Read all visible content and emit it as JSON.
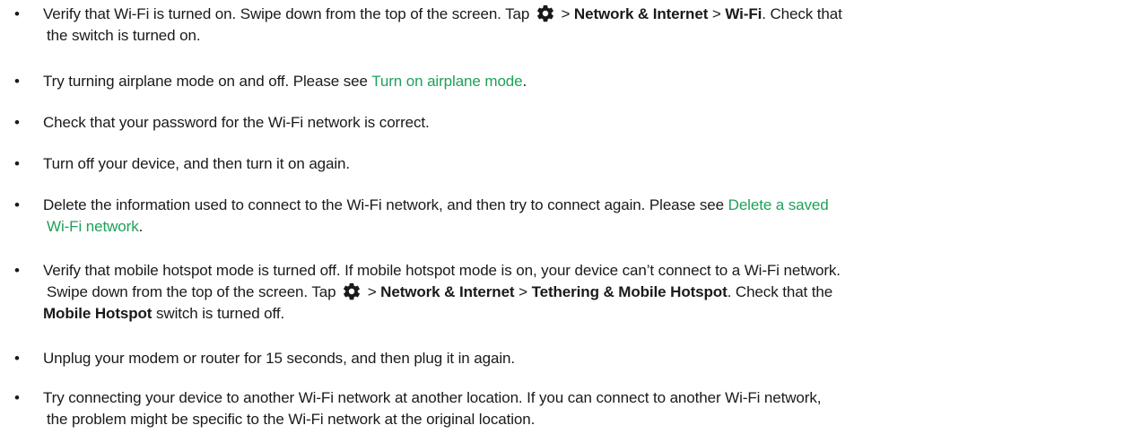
{
  "bullets": "•",
  "items": [
    {
      "line1_a": "Verify that Wi-Fi is turned on. Swipe down from the top of the screen. Tap ",
      "line1_b": " > ",
      "line1_c": "Network & Internet",
      "line1_d": " > ",
      "line1_e": "Wi-Fi",
      "line1_f": ". Check that",
      "line2": "the switch is turned on."
    },
    {
      "text": "Try turning airplane mode on and off. Please see ",
      "link": "Turn on airplane mode",
      "end": "."
    },
    {
      "text": "Check that your password for the Wi-Fi network is correct."
    },
    {
      "text": "Turn off your device, and then turn it on again."
    },
    {
      "line1": "Delete the information used to connect to the Wi-Fi network, and then try to connect again. Please see ",
      "link1": "Delete a saved",
      "link2": "Wi-Fi network",
      "end": "."
    },
    {
      "line1": "Verify that mobile hotspot mode is turned off. If mobile hotspot mode is on, your device can’t connect to a Wi-Fi network.",
      "line2_a": "Swipe down from the top of the screen. Tap ",
      "line2_b": " > ",
      "line2_c": "Network & Internet",
      "line2_d": " > ",
      "line2_e": "Tethering & Mobile Hotspot",
      "line2_f": ". Check that the",
      "line3_a": "Mobile Hotspot",
      "line3_b": " switch is turned off."
    },
    {
      "text": "Unplug your modem or router for 15 seconds, and then plug it in again."
    },
    {
      "line1": "Try connecting your device to another Wi-Fi network at another location. If you can connect to another Wi-Fi network,",
      "line2": "the problem might be specific to the Wi-Fi network at the original location."
    }
  ],
  "icons": {
    "settings": "gear-icon"
  },
  "colors": {
    "link": "#1fa05a",
    "text": "#1a1a1a"
  }
}
